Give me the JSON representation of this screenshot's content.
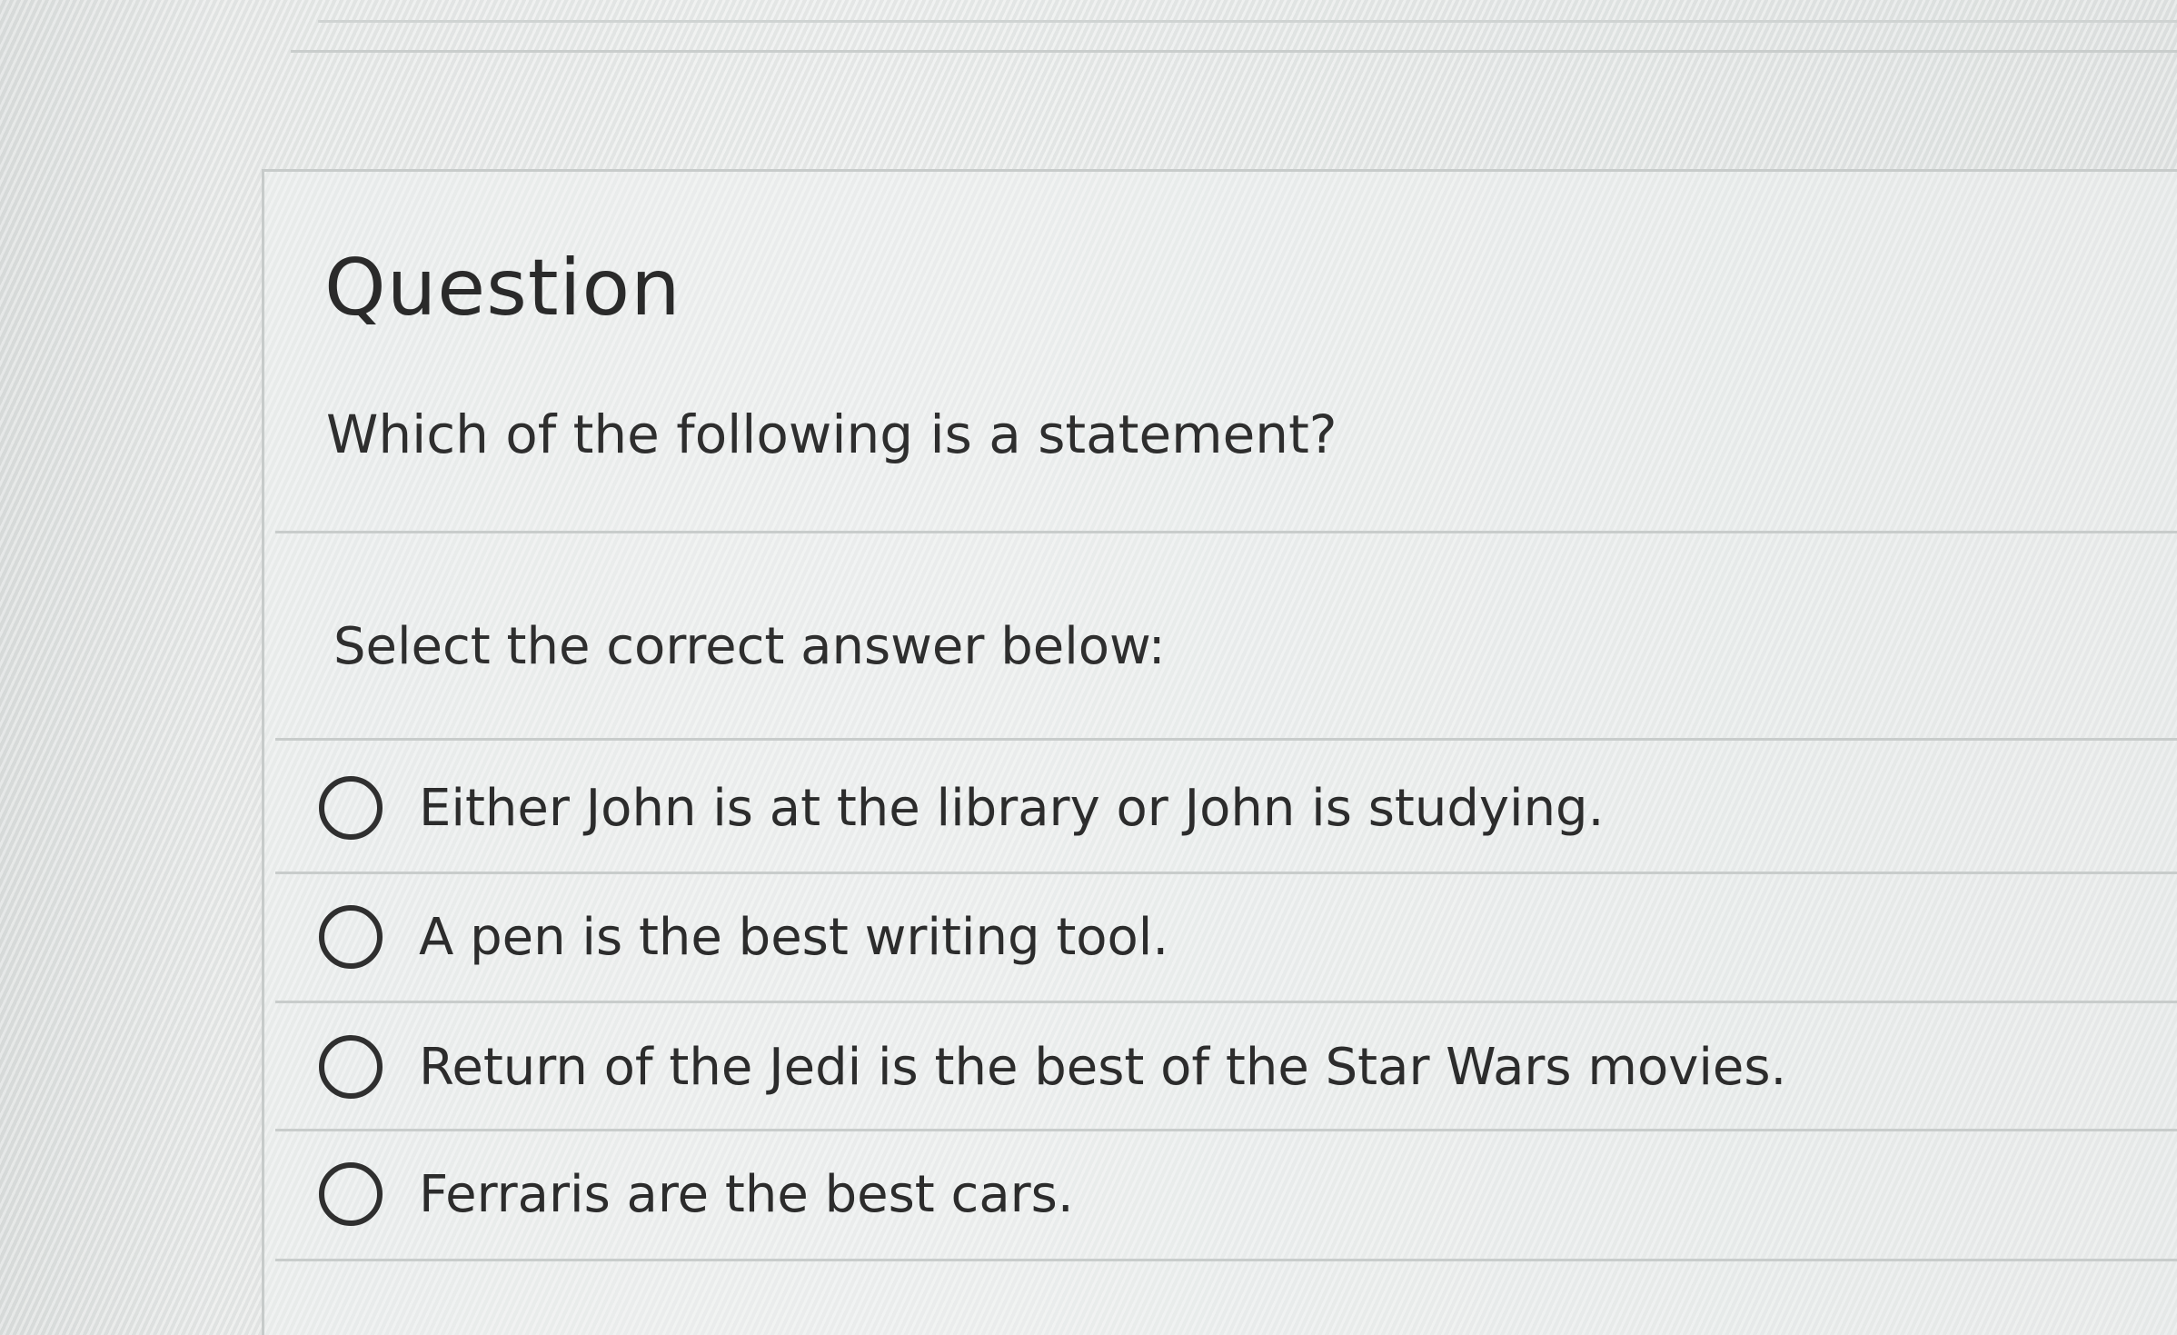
{
  "header": {
    "title": "Question"
  },
  "question": {
    "text": "Which of the following is a statement?",
    "instruction": "Select the correct answer below:"
  },
  "options": [
    {
      "label": "Either John is at the library or John is studying.",
      "selected": false
    },
    {
      "label": "A pen is the best writing tool.",
      "selected": false
    },
    {
      "label": "Return of the Jedi is the best of the Star Wars movies.",
      "selected": false
    },
    {
      "label": "Ferraris are the best cars.",
      "selected": false
    }
  ],
  "icons": {
    "radio": "radio-unchecked-icon"
  }
}
